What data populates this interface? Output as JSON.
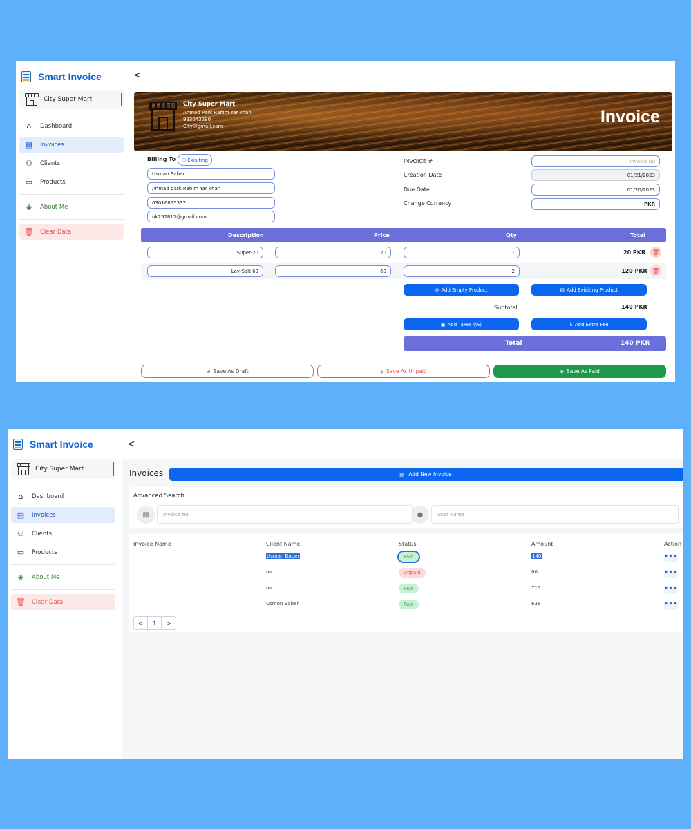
{
  "app": {
    "name": "Smart Invoice",
    "store": "City Super Mart",
    "collapse": "<"
  },
  "nav": {
    "dashboard": "Dashboard",
    "invoices": "Invoices",
    "clients": "Clients",
    "products": "Products",
    "about": "About Me",
    "clear": "Clear Data"
  },
  "invoice_form": {
    "banner": {
      "store_name": "City Super Mart",
      "address": "Ahmad Park Rahim Yar khan",
      "phone": "923043290",
      "email": "City@gmail.com",
      "title": "Invoice"
    },
    "billing_label": "Billing To",
    "existing_button": "Exisiting",
    "client": {
      "name": "Usman Baber",
      "address": "Ahmad park Rahim Yar khan",
      "phone": "03016855337",
      "email": "uk252811@gmail.com"
    },
    "meta": {
      "invoice_label": "INVOICE #",
      "invoice_placeholder": "Invoice No",
      "creation_label": "Creation Date",
      "creation_value": "01/21/2023",
      "due_label": "Due Date",
      "due_value": "01/20/2023",
      "currency_label": "Change Currency",
      "currency_value": "PKR"
    },
    "columns": [
      "Description",
      "Price",
      "Qty",
      "Total"
    ],
    "items": [
      {
        "description": "Super-20",
        "price": "20",
        "qty": "1",
        "total": "20 PKR"
      },
      {
        "description": "Lay-Salt 60",
        "price": "60",
        "qty": "2",
        "total": "120 PKR"
      }
    ],
    "add_empty": "Add Empty Product",
    "add_existing": "Add Exisiting Product",
    "subtotal_label": "Subtotal",
    "subtotal_value": "140 PKR",
    "add_taxes": "Add Taxes (%)",
    "add_fee": "Add Extra Fee",
    "total_label": "Total",
    "total_value": "140 PKR",
    "save_draft": "Save As Draft",
    "save_unpaid": "Save As Unpaid",
    "save_paid": "Save As Paid"
  },
  "invoice_list": {
    "title": "Invoices",
    "add_new": "Add New Invoice",
    "advanced_search": "Advanced Search",
    "invoice_placeholder": "Invoice No",
    "user_placeholder": "User Name",
    "columns": [
      "Invoice Name",
      "Client Name",
      "Status",
      "Amount",
      "Action"
    ],
    "rows": [
      {
        "client": "Usman Baber",
        "status": "Paid",
        "amount": "140",
        "action": "•••"
      },
      {
        "client": "mr",
        "status": "Unpaid",
        "amount": "60",
        "action": "•••"
      },
      {
        "client": "mr",
        "status": "Paid",
        "amount": "715",
        "action": "•••"
      },
      {
        "client": "Usmon Baber",
        "status": "Paid",
        "amount": "638",
        "action": "•••"
      }
    ],
    "pager": {
      "prev": "<",
      "page": "1",
      "next": ">"
    }
  },
  "colors": {
    "primary": "#0b66f0",
    "header": "#6a6fdc",
    "paid": "#1c9a4a",
    "unpaid": "#e05a5a",
    "background": "#5eb0fb"
  }
}
